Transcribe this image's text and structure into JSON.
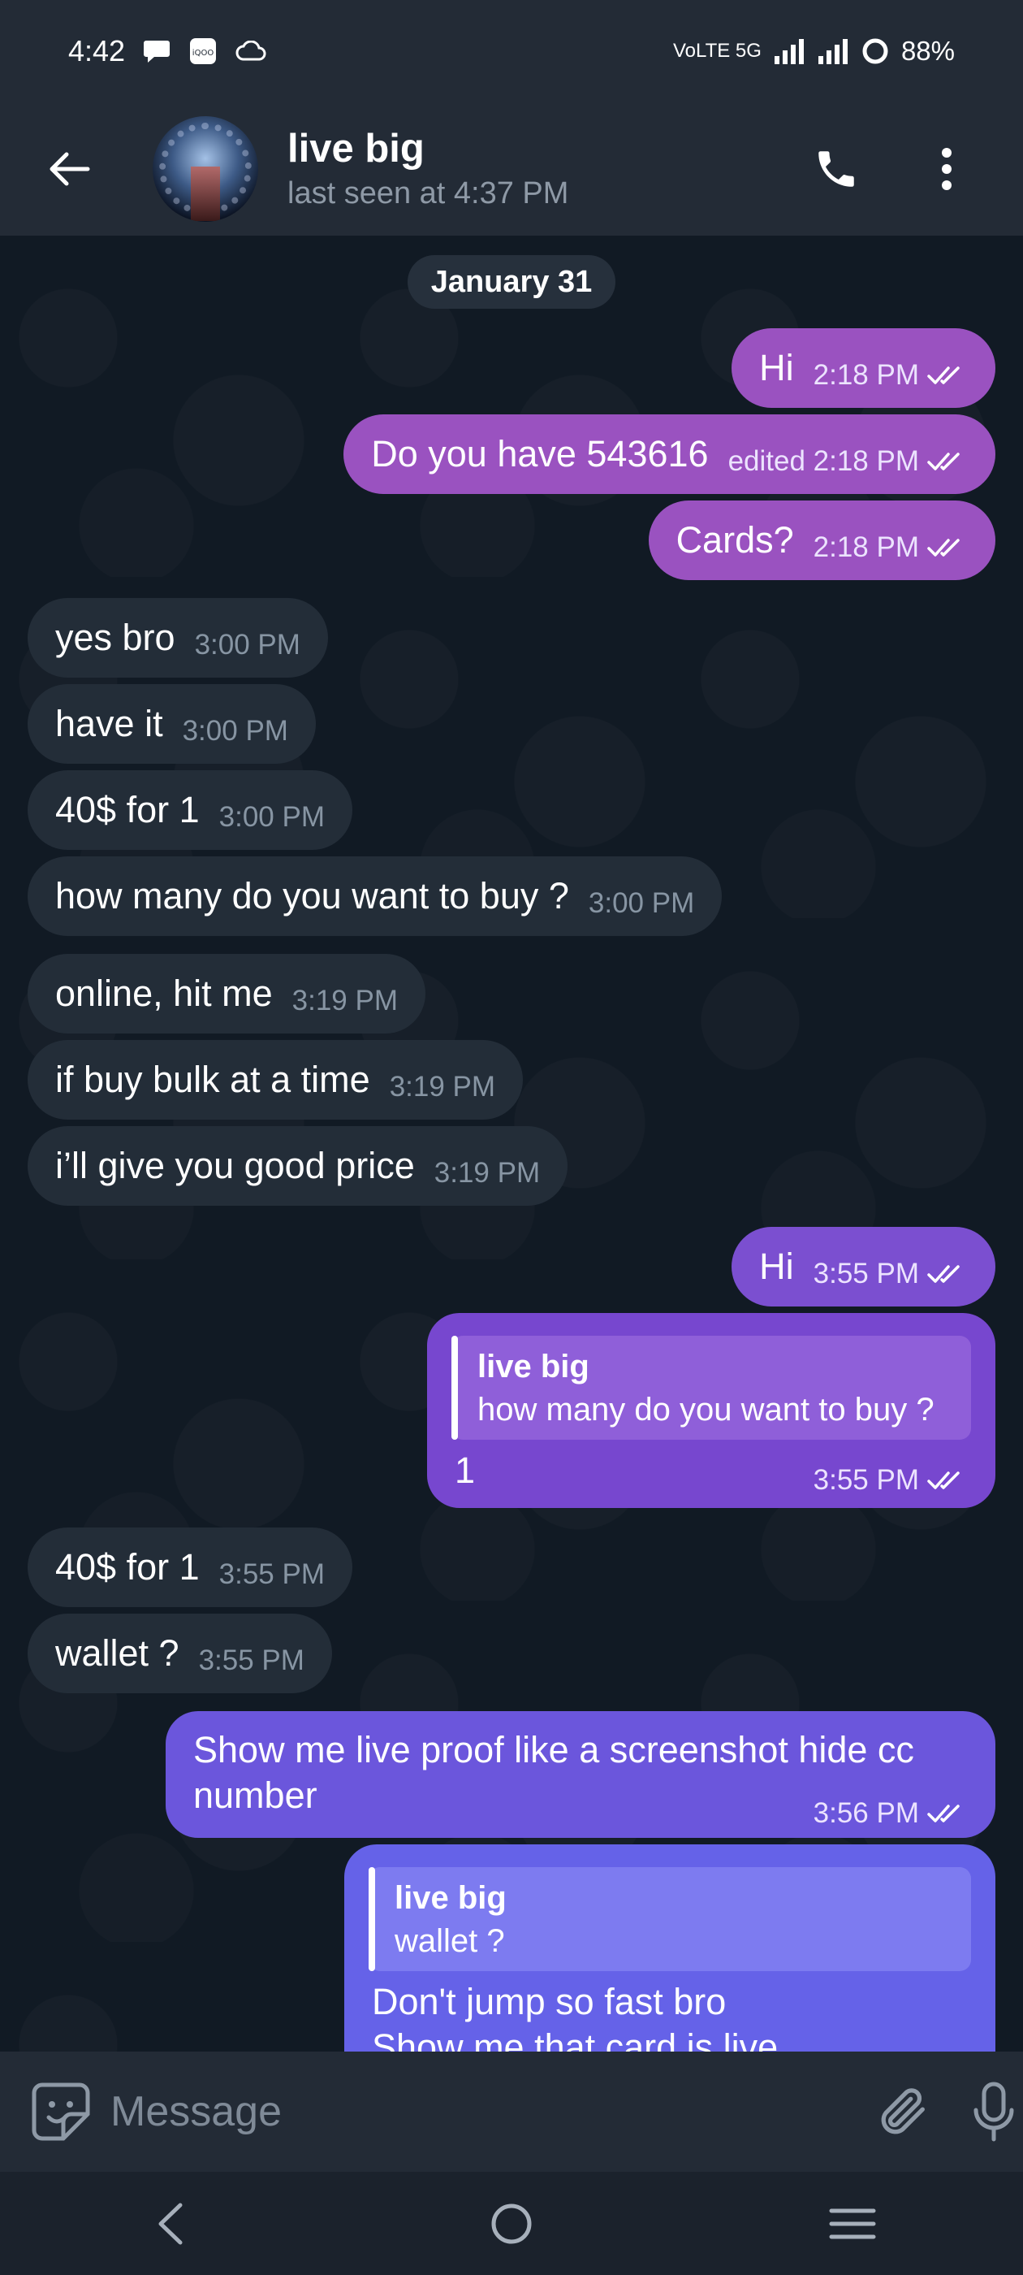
{
  "status_bar": {
    "time": "4:42",
    "network": "VoLTE 5G",
    "battery": "88%"
  },
  "header": {
    "name": "live big",
    "last_seen": "last seen at 4:37 PM"
  },
  "chat": {
    "date_chip": "January 31",
    "messages": [
      {
        "dir": "out",
        "text": "Hi",
        "time": "2:18 PM",
        "color": "#9a52c0"
      },
      {
        "dir": "out",
        "text": "Do you have 543616",
        "time": "edited 2:18 PM",
        "color": "#9a52c0"
      },
      {
        "dir": "out",
        "text": "Cards?",
        "time": "2:18 PM",
        "color": "#9a52c0"
      },
      {
        "dir": "in",
        "text": "yes bro",
        "time": "3:00 PM"
      },
      {
        "dir": "in",
        "text": "have it",
        "time": "3:00 PM"
      },
      {
        "dir": "in",
        "text": "40$ for 1",
        "time": "3:00 PM"
      },
      {
        "dir": "in",
        "text": "how many do you want to buy ?",
        "time": "3:00 PM"
      },
      {
        "dir": "in",
        "text": "online, hit me",
        "time": "3:19 PM"
      },
      {
        "dir": "in",
        "text": "if buy bulk at a time",
        "time": "3:19 PM"
      },
      {
        "dir": "in",
        "text": "i’ll give you good price",
        "time": "3:19 PM"
      },
      {
        "dir": "out",
        "text": "Hi",
        "time": "3:55 PM",
        "color": "#7b4fd0"
      },
      {
        "dir": "in",
        "text": "40$ for 1",
        "time": "3:55 PM"
      },
      {
        "dir": "in",
        "text": "wallet ?",
        "time": "3:55 PM"
      }
    ],
    "reply_1": {
      "quote_name": "live big",
      "quote_text": "how many do you want to buy ?",
      "text": "1",
      "time": "3:55 PM"
    },
    "long_msg": {
      "line1": "Show me live proof like a screenshot hide cc",
      "line2": "number",
      "time": "3:56 PM"
    },
    "reply_2": {
      "quote_name": "live big",
      "quote_text": "wallet ?",
      "line1": "Don't jump so fast bro",
      "line2": "Show me that card is live"
    }
  },
  "input": {
    "placeholder": "Message"
  },
  "colors": {
    "bar_bg": "#232b36",
    "incoming_bubble": "#232d38",
    "outgoing_purple": "#9a52c0",
    "outgoing_violet": "#7b4fd0",
    "outgoing_indigo": "#6a5de6"
  }
}
